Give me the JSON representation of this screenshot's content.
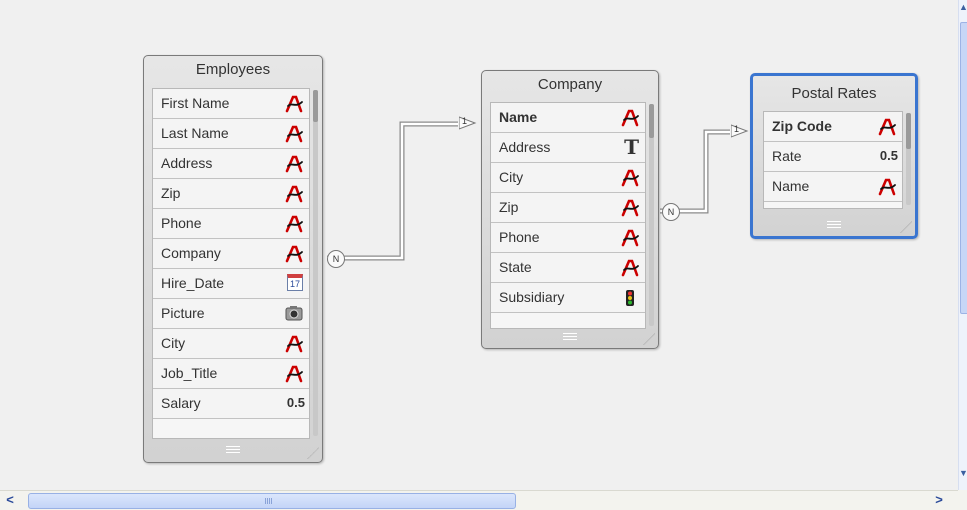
{
  "tables": {
    "employees": {
      "title": "Employees",
      "fields": [
        {
          "name": "First Name",
          "icon": "text-alpha-icon"
        },
        {
          "name": "Last Name",
          "icon": "text-alpha-icon"
        },
        {
          "name": "Address",
          "icon": "text-alpha-icon"
        },
        {
          "name": "Zip",
          "icon": "text-alpha-icon"
        },
        {
          "name": "Phone",
          "icon": "text-alpha-icon"
        },
        {
          "name": "Company",
          "icon": "text-alpha-icon"
        },
        {
          "name": "Hire_Date",
          "icon": "calendar-icon",
          "icon_text": "17"
        },
        {
          "name": "Picture",
          "icon": "camera-icon"
        },
        {
          "name": "City",
          "icon": "text-alpha-icon"
        },
        {
          "name": "Job_Title",
          "icon": "text-alpha-icon"
        },
        {
          "name": "Salary",
          "icon": "decimal-icon",
          "icon_text": "0.5"
        }
      ]
    },
    "company": {
      "title": "Company",
      "fields": [
        {
          "name": "Name",
          "icon": "text-alpha-icon",
          "key": true
        },
        {
          "name": "Address",
          "icon": "text-T-icon",
          "icon_text": "T"
        },
        {
          "name": "City",
          "icon": "text-alpha-icon"
        },
        {
          "name": "Zip",
          "icon": "text-alpha-icon"
        },
        {
          "name": "Phone",
          "icon": "text-alpha-icon"
        },
        {
          "name": "State",
          "icon": "text-alpha-icon"
        },
        {
          "name": "Subsidiary",
          "icon": "traffic-light-icon"
        }
      ]
    },
    "postal_rates": {
      "title": "Postal Rates",
      "fields": [
        {
          "name": "Zip Code",
          "icon": "text-alpha-icon",
          "key": true
        },
        {
          "name": "Rate",
          "icon": "decimal-icon",
          "icon_text": "0.5"
        },
        {
          "name": "Name",
          "icon": "text-alpha-icon"
        }
      ]
    }
  },
  "relations": [
    {
      "from": "Employees",
      "to": "Company",
      "many_label": "N",
      "one_label": "1"
    },
    {
      "from": "Company",
      "to": "Postal Rates",
      "many_label": "N",
      "one_label": "1"
    }
  ],
  "colors": {
    "canvas": "#f0f0f0",
    "selected_border": "#3a75d0",
    "alpha_icon": "#cc0000"
  }
}
